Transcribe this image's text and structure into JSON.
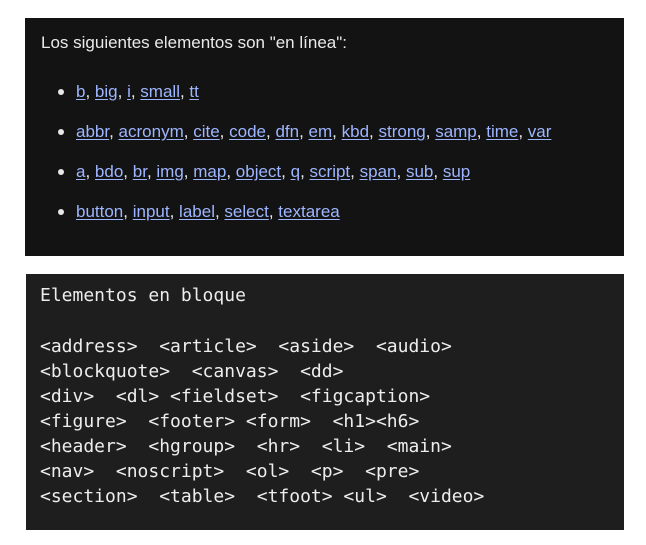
{
  "inline_panel": {
    "heading": "Los siguientes elementos son \"en línea\":",
    "rows": [
      [
        "b",
        "big",
        "i",
        "small",
        "tt"
      ],
      [
        "abbr",
        "acronym",
        "cite",
        "code",
        "dfn",
        "em",
        "kbd",
        "strong",
        "samp",
        "time",
        "var"
      ],
      [
        "a",
        "bdo",
        "br",
        "img",
        "map",
        "object",
        "q",
        "script",
        "span",
        "sub",
        "sup"
      ],
      [
        "button",
        "input",
        "label",
        "select",
        "textarea"
      ]
    ],
    "separator": ", "
  },
  "block_panel": {
    "heading": "Elementos en bloque",
    "lines": [
      "<address>  <article>  <aside>  <audio>",
      "<blockquote>  <canvas>  <dd>",
      "<div>  <dl> <fieldset>  <figcaption>",
      "<figure>  <footer> <form>  <h1><h6>",
      "<header>  <hgroup>  <hr>  <li>  <main>",
      "<nav>  <noscript>  <ol>  <p>  <pre>",
      "<section>  <table>  <tfoot> <ul>  <video>"
    ]
  },
  "colors": {
    "panel_background": "#131313",
    "code_background": "#1e1e1e",
    "link": "#9eb5ff",
    "text": "#eaeaea"
  }
}
